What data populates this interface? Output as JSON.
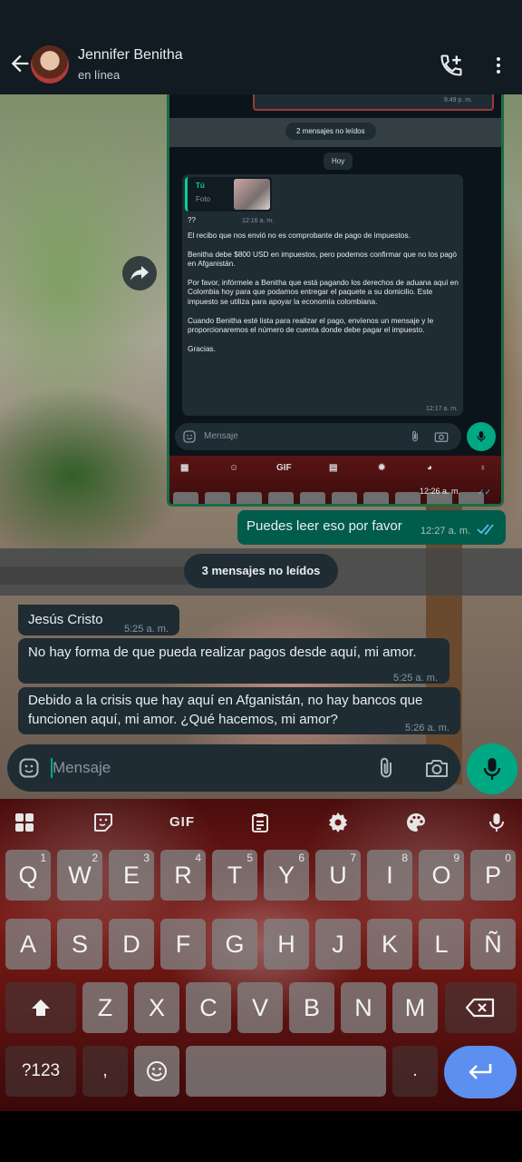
{
  "header": {
    "contact_name": "Jennifer Benitha",
    "status": "en línea"
  },
  "embedded_screenshot": {
    "prev_message_time": "9:49 p. m.",
    "unread_banner": "2 mensajes no leídos",
    "day_label": "Hoy",
    "quote_author": "Tú",
    "quote_type": "Foto",
    "quote_reply": "??",
    "quote_reply_time": "12:16 a. m.",
    "message_text": "El recibo que nos envió no es comprobante de pago de impuestos.\n\nBenitha debe $800 USD en impuestos, pero podemos confirmar que no los pagó en Afganistán.\n\nPor favor, infórmele a Benitha que está pagando los derechos de aduana aquí en Colombia hoy para que podamos entregar el paquete a su domicilio. Este impuesto se utiliza para apoyar la economía colombiana.\n\nCuando Benitha esté lista para realizar el pago, envíenos un mensaje y le proporcionaremos el número de cuenta donde debe pagar el impuesto.\n\nGracias.",
    "message_time": "12:17 a. m.",
    "input_placeholder": "Mensaje",
    "keyboard_gif": "GIF",
    "last_time": "12:26 a. m."
  },
  "messages": {
    "outgoing": {
      "text": "Puedes leer eso por favor",
      "time": "12:27 a. m."
    },
    "unread_banner": "3 mensajes no leídos",
    "incoming": [
      {
        "text": "Jesús Cristo",
        "time": "5:25 a. m."
      },
      {
        "text": "No hay forma de que pueda realizar pagos desde aquí, mi amor.",
        "time": "5:25 a. m."
      },
      {
        "text": "Debido a la crisis que hay aquí en Afganistán, no hay bancos que funcionen aquí, mi amor. ¿Qué hacemos, mi amor?",
        "time": "5:26 a. m."
      }
    ]
  },
  "composer": {
    "placeholder": "Mensaje"
  },
  "keyboard": {
    "gif_label": "GIF",
    "row1": [
      {
        "k": "Q",
        "h": "1"
      },
      {
        "k": "W",
        "h": "2"
      },
      {
        "k": "E",
        "h": "3"
      },
      {
        "k": "R",
        "h": "4"
      },
      {
        "k": "T",
        "h": "5"
      },
      {
        "k": "Y",
        "h": "6"
      },
      {
        "k": "U",
        "h": "7"
      },
      {
        "k": "I",
        "h": "8"
      },
      {
        "k": "O",
        "h": "9"
      },
      {
        "k": "P",
        "h": "0"
      }
    ],
    "row2": [
      "A",
      "S",
      "D",
      "F",
      "G",
      "H",
      "J",
      "K",
      "L",
      "Ñ"
    ],
    "row3": [
      "Z",
      "X",
      "C",
      "V",
      "B",
      "N",
      "M"
    ],
    "symbols_label": "?123",
    "comma_label": ",",
    "period_label": "."
  },
  "colors": {
    "accent": "#00a884",
    "outgoing_bubble": "#005c4b",
    "incoming_bubble": "#1f2c33",
    "read_ticks": "#53bdeb",
    "enter_key": "#5b8ff0"
  },
  "icons": [
    "back-arrow-icon",
    "add-call-icon",
    "more-vert-icon",
    "forward-icon",
    "emoji-icon",
    "attach-icon",
    "camera-icon",
    "mic-icon",
    "apps-icon",
    "sticker-icon",
    "clipboard-icon",
    "settings-icon",
    "palette-icon",
    "voice-icon",
    "shift-icon",
    "backspace-icon",
    "enter-icon"
  ]
}
